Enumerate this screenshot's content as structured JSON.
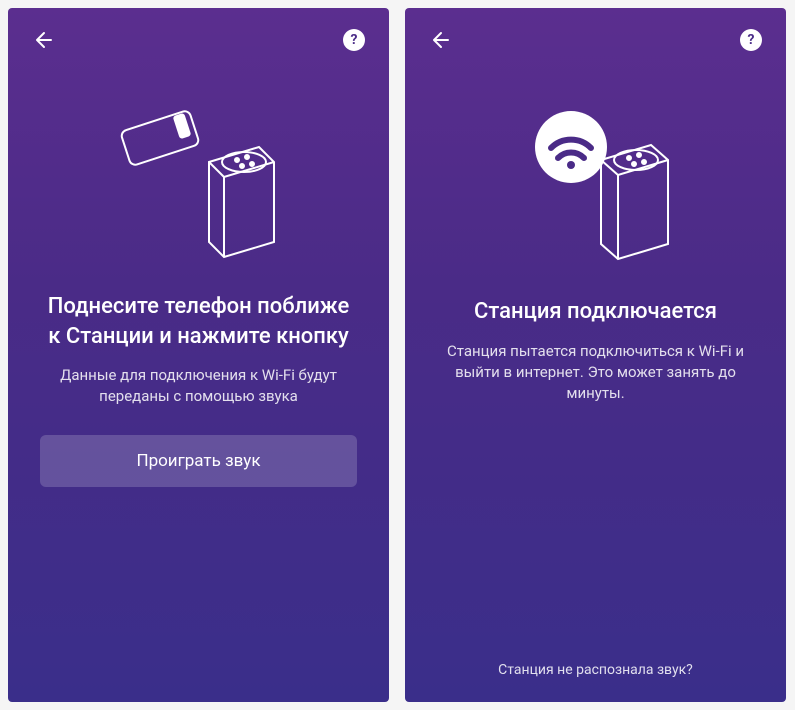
{
  "screens": {
    "left": {
      "title": "Поднесите телефон поближе  к Станции и нажмите кнопку",
      "description": "Данные для подключения к Wi-Fi будут переданы с помощью звука",
      "button_label": "Проиграть звук"
    },
    "right": {
      "title": "Станция подключается",
      "description": "Станция пытается подключиться к Wi-Fi и выйти в интернет. Это может занять до минуты.",
      "footer_link": "Станция не распознала звук?"
    }
  },
  "help_glyph": "?"
}
